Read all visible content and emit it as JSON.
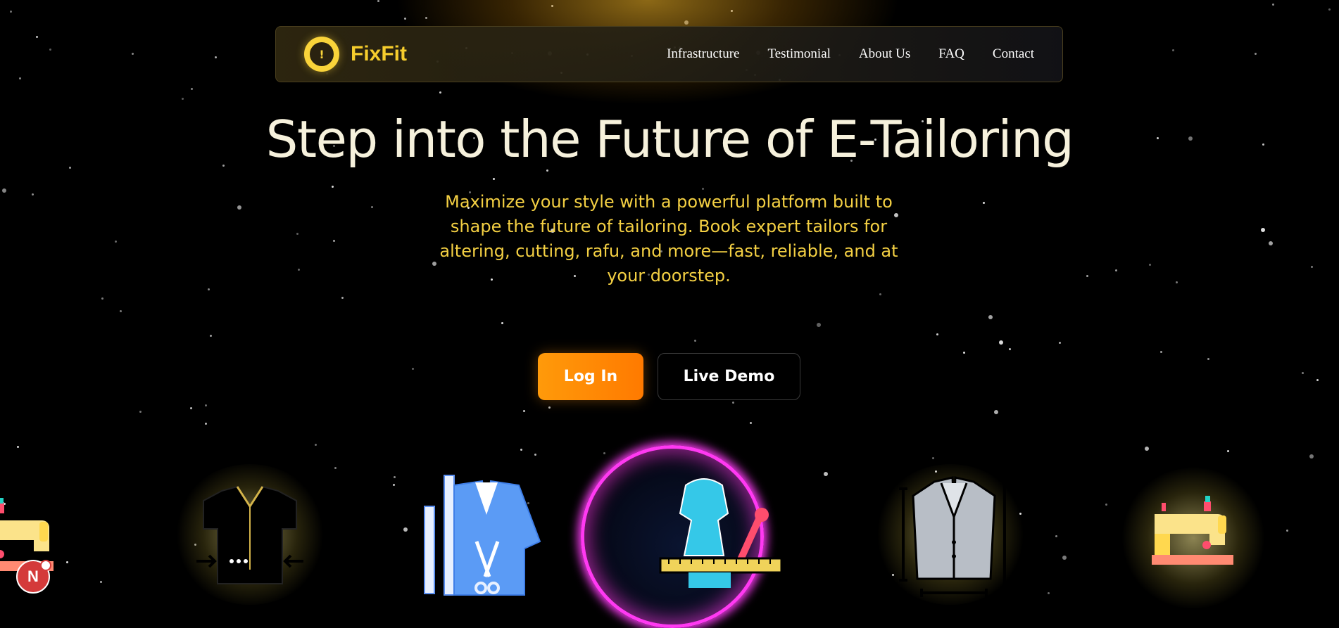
{
  "brand": {
    "name": "FixFit",
    "logo_glyph": "!",
    "color": "#f6cd2d"
  },
  "nav": {
    "links": [
      "Infrastructure",
      "Testimonial",
      "About Us",
      "FAQ",
      "Contact"
    ]
  },
  "hero": {
    "headline": "Step into the Future of E-Tailoring",
    "subheading": "Maximize your style with a powerful platform built to shape the future of tailoring. Book expert tailors for altering, cutting, rafu, and more—fast, reliable, and at your doorstep.",
    "subheading_color": "#f4d043"
  },
  "actions": {
    "login_label": "Log In",
    "demo_label": "Live Demo",
    "accent": "#ff8c00"
  },
  "carousel": {
    "icons": [
      "sewing-machine-icon",
      "shirt-cutting-icon",
      "blazer-scissors-icon",
      "dress-measure-icon",
      "suit-measure-icon",
      "sewing-machine-icon"
    ]
  },
  "dev_badge": {
    "label": "N"
  }
}
